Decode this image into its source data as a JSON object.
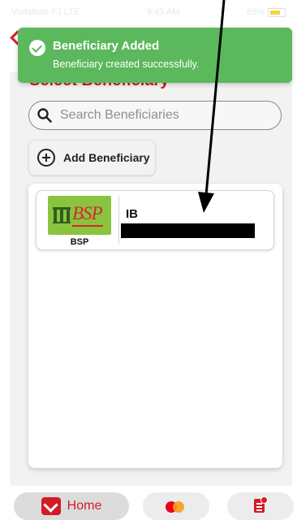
{
  "status_bar": {
    "carrier": "Vodafone FJ LTE",
    "time": "9:45 AM",
    "battery": "85%"
  },
  "toast": {
    "title": "Beneficiary Added",
    "message": "Beneficiary created successfully."
  },
  "page": {
    "section_title": "Select Beneficiary"
  },
  "search": {
    "placeholder": "Search Beneficiaries"
  },
  "add_button": {
    "label": "Add Beneficiary"
  },
  "beneficiaries": [
    {
      "name": "IB",
      "bank_code": "BSP",
      "logo_text": "BSP"
    }
  ],
  "bottom_nav": {
    "home_label": "Home",
    "items": [
      "home-icon",
      "card-icon",
      "schedule-icon"
    ]
  },
  "colors": {
    "brand": "#d31b25",
    "toast": "#5cb85c",
    "bank_logo_bg": "#8ac43f"
  }
}
